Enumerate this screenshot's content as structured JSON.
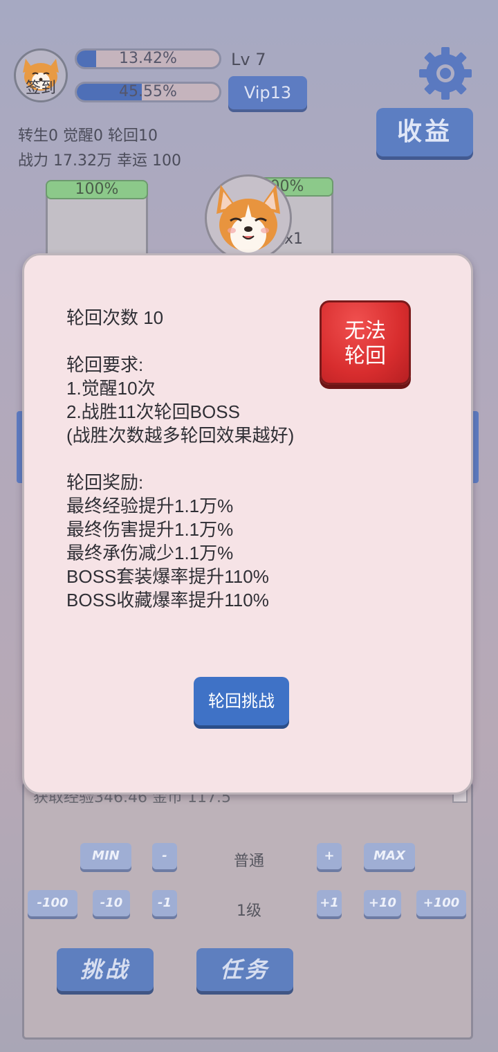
{
  "hud": {
    "sign_in": "签到",
    "exp_percent_text": "13.42%",
    "exp_percent": 13.42,
    "level": "Lv 7",
    "hp_percent_text": "45.55%",
    "hp_percent": 45.55,
    "vip": "Vip13",
    "income_button": "收益",
    "stats_line1": "转生0 觉醒0 轮回10",
    "stats_line2": "战力 17.32万  幸运 100"
  },
  "cards": {
    "left_bar": "100%",
    "right_bar": "100%",
    "right_label": "怪x1"
  },
  "modal": {
    "lines": "轮回次数 10\n\n轮回要求:\n1.觉醒10次\n2.战胜11次轮回BOSS\n(战胜次数越多轮回效果越好)\n\n轮回奖励:\n最终经验提升1.1万%\n最终伤害提升1.1万%\n最终承伤减少1.1万%\nBOSS套装爆率提升110%\nBOSS收藏爆率提升110%",
    "status_button_line1": "无法",
    "status_button_line2": "轮回",
    "challenge_button": "轮回挑战"
  },
  "bottom": {
    "behind_text": "获取经验346.46  金币 117.5",
    "min": "MIN",
    "minus": "-",
    "difficulty": "普通",
    "plus": "+",
    "max": "MAX",
    "minus100": "-100",
    "minus10": "-10",
    "minus1": "-1",
    "level_label": "1级",
    "plus1": "+1",
    "plus10": "+10",
    "plus100": "+100",
    "challenge": "挑战",
    "task": "任务"
  },
  "colors": {
    "accent_blue": "#5e7fbf",
    "danger_red": "#d82d2e",
    "modal_bg": "#f6e3e6"
  }
}
